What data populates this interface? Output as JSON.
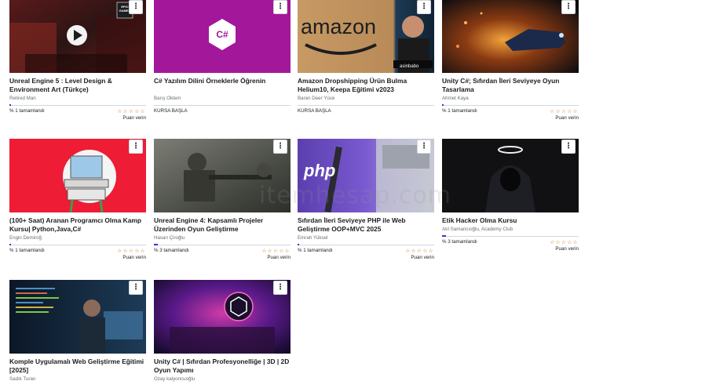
{
  "courses": [
    {
      "title": "Unreal Engine 5 : Level Design & Environment Art (Türkçe)",
      "instructor": "Retired Man",
      "status_text": "% 1 tamamlandı",
      "progress": 0.01,
      "rating_text": "Puan verin",
      "stars": "☆☆☆☆☆",
      "menu_icon": "more-vertical-icon",
      "thumb_badge": "EPIC GAMES"
    },
    {
      "title": "C# Yazılım Dilini Örneklerle Öğrenin",
      "instructor": "Barış Öktem",
      "status_text": "KURSA BAŞLA",
      "menu_icon": "more-vertical-icon",
      "thumb_logo": "C#"
    },
    {
      "title": "Amazon Dropshipping Ürün Bulma Helium10, Keepa Eğitimi v2023",
      "instructor": "Baran Deer Yüce",
      "status_text": "KURSA BAŞLA",
      "menu_icon": "more-vertical-icon",
      "thumb_logo": "amazon",
      "thumb_badge": "asinbabo"
    },
    {
      "title": "Unity C#; Sıfırdan İleri Seviyeye Oyun Tasarlama",
      "instructor": "Ahmet Kaya",
      "status_text": "% 1 tamamlandı",
      "progress": 0.01,
      "rating_text": "Puan verin",
      "stars": "☆☆☆☆☆",
      "menu_icon": "more-vertical-icon"
    },
    {
      "title": "(100+ Saat) Aranan Programcı Olma Kamp Kursu| Python,Java,C#",
      "instructor": "Engin Demiroğ",
      "status_text": "% 1 tamamlandı",
      "progress": 0.01,
      "rating_text": "Puan verin",
      "stars": "☆☆☆☆☆",
      "menu_icon": "more-vertical-icon"
    },
    {
      "title": "Unreal Engine 4: Kapsamlı Projeler Üzerinden Oyun Geliştirme",
      "instructor": "Hasan Çiroğlu",
      "status_text": "% 3 tamamlandı",
      "progress": 0.03,
      "rating_text": "Puan verin",
      "stars": "☆☆☆☆☆",
      "menu_icon": "more-vertical-icon"
    },
    {
      "title": "Sıfırdan İleri Seviyeye PHP ile Web Geliştirme OOP+MVC 2025",
      "instructor": "Emrah Yüksel",
      "status_text": "% 1 tamamlandı",
      "progress": 0.01,
      "rating_text": "Puan verin",
      "stars": "☆☆☆☆☆",
      "menu_icon": "more-vertical-icon",
      "thumb_logo": "php"
    },
    {
      "title": "Etik Hacker Olma Kursu",
      "instructor": "Atıl Samancıoğlu, Academy Club",
      "status_text": "% 3 tamamlandı",
      "progress": 0.03,
      "rating_text": "Puan verin",
      "stars": "☆☆☆☆☆",
      "menu_icon": "more-vertical-icon"
    },
    {
      "title": "Komple Uygulamalı Web Geliştirme Eğitimi [2025]",
      "instructor": "Sadık Turan",
      "menu_icon": "more-vertical-icon"
    },
    {
      "title": "Unity C# | Sıfırdan Profesyonelliğe | 3D | 2D Oyun Yapımı",
      "instructor": "Ozay kalyoncuoğlu",
      "menu_icon": "more-vertical-icon"
    }
  ],
  "menu_glyph": "⋮",
  "watermark": "itemhesap.com"
}
